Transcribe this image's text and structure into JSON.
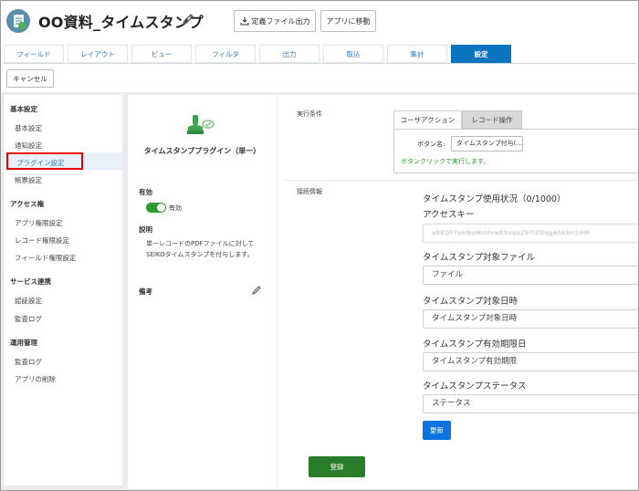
{
  "header": {
    "app_title": "OO資料_タイムスタンプ",
    "export_button": "定義ファイル出力",
    "goto_app_button": "アプリに移動"
  },
  "tabs": [
    {
      "label": "フィールド"
    },
    {
      "label": "レイアウト"
    },
    {
      "label": "ビュー"
    },
    {
      "label": "フィルタ"
    },
    {
      "label": "出力"
    },
    {
      "label": "取込"
    },
    {
      "label": "集計"
    },
    {
      "label": "設定",
      "active": true
    }
  ],
  "cancel_button": "キャンセル",
  "sidebar": {
    "section_basic": "基本設定",
    "basic_items": [
      "基本設定",
      "通知設定",
      "プラグイン設定",
      "帳票設定"
    ],
    "section_access": "アクセス権",
    "access_items": [
      "アプリ権限設定",
      "レコード権限設定",
      "フィールド権限設定"
    ],
    "section_service": "サービス連携",
    "service_items": [
      "認証設定",
      "監査ログ"
    ],
    "section_ops": "運用管理",
    "ops_items": [
      "監査ログ",
      "アプリの削除"
    ]
  },
  "plugin": {
    "name": "タイムスタンププラグイン（単一）",
    "enabled_label": "有効",
    "toggle_text": "有効",
    "enabled": true,
    "description_label": "説明",
    "description_line1": "単一レコードのPDFファイルに対して",
    "description_line2": "SEIKOタイムスタンプを付与します。",
    "notes_label": "備考"
  },
  "settings": {
    "exec_label": "実行条件",
    "subtab_user_action": "ユーザアクション",
    "subtab_record_op": "レコード操作",
    "button_name_label": "ボタン名:",
    "button_name_value": "タイムスタンプ付与(...",
    "exec_hint": "ボタンクリックで実行します。",
    "connection_label": "接続情報",
    "usage_status": "タイムスタンプ使用状況（0/1000）",
    "access_key_label": "アクセスキー",
    "access_key_value": "aRKQFYpkNqWuUvwKSoqaZbYiZDqgAhKbn1HW",
    "target_file_label": "タイムスタンプ対象ファイル",
    "target_file_value": "ファイル",
    "target_datetime_label": "タイムスタンプ対象日時",
    "target_datetime_value": "タイムスタンプ対象日時",
    "expiry_label": "タイムスタンプ有効期限日",
    "expiry_value": "タイムスタンプ有効期限",
    "status_label": "タイムスタンプステータス",
    "status_value": "ステータス",
    "update_button": "更新",
    "register_button": "登録"
  }
}
